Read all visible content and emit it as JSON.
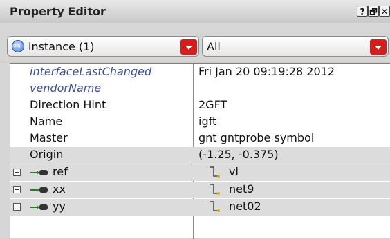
{
  "window": {
    "title": "Property Editor",
    "buttons": {
      "help": "?",
      "float": "🗗",
      "close": "✕"
    }
  },
  "toolbar": {
    "object_combo": {
      "value": "instance (1)",
      "icon": "object-icon"
    },
    "filter_combo": {
      "value": "All"
    },
    "accent_color": "#d41e1e"
  },
  "properties": [
    {
      "name": "interfaceLastChanged",
      "value": "Fri Jan 20 09:19:28 2012",
      "italic": true
    },
    {
      "name": "vendorName",
      "value": "",
      "italic": true
    },
    {
      "name": "Direction Hint",
      "value": "2GFT",
      "italic": false
    },
    {
      "name": "Name",
      "value": "igft",
      "italic": false
    },
    {
      "name": "Master",
      "value": "gnt gntprobe symbol",
      "italic": false
    },
    {
      "name": "Origin",
      "value": "(-1.25, -0.375)",
      "italic": false
    }
  ],
  "terminals": [
    {
      "name": "ref",
      "net": "vi"
    },
    {
      "name": "xx",
      "net": "net9"
    },
    {
      "name": "yy",
      "net": "net02"
    }
  ]
}
